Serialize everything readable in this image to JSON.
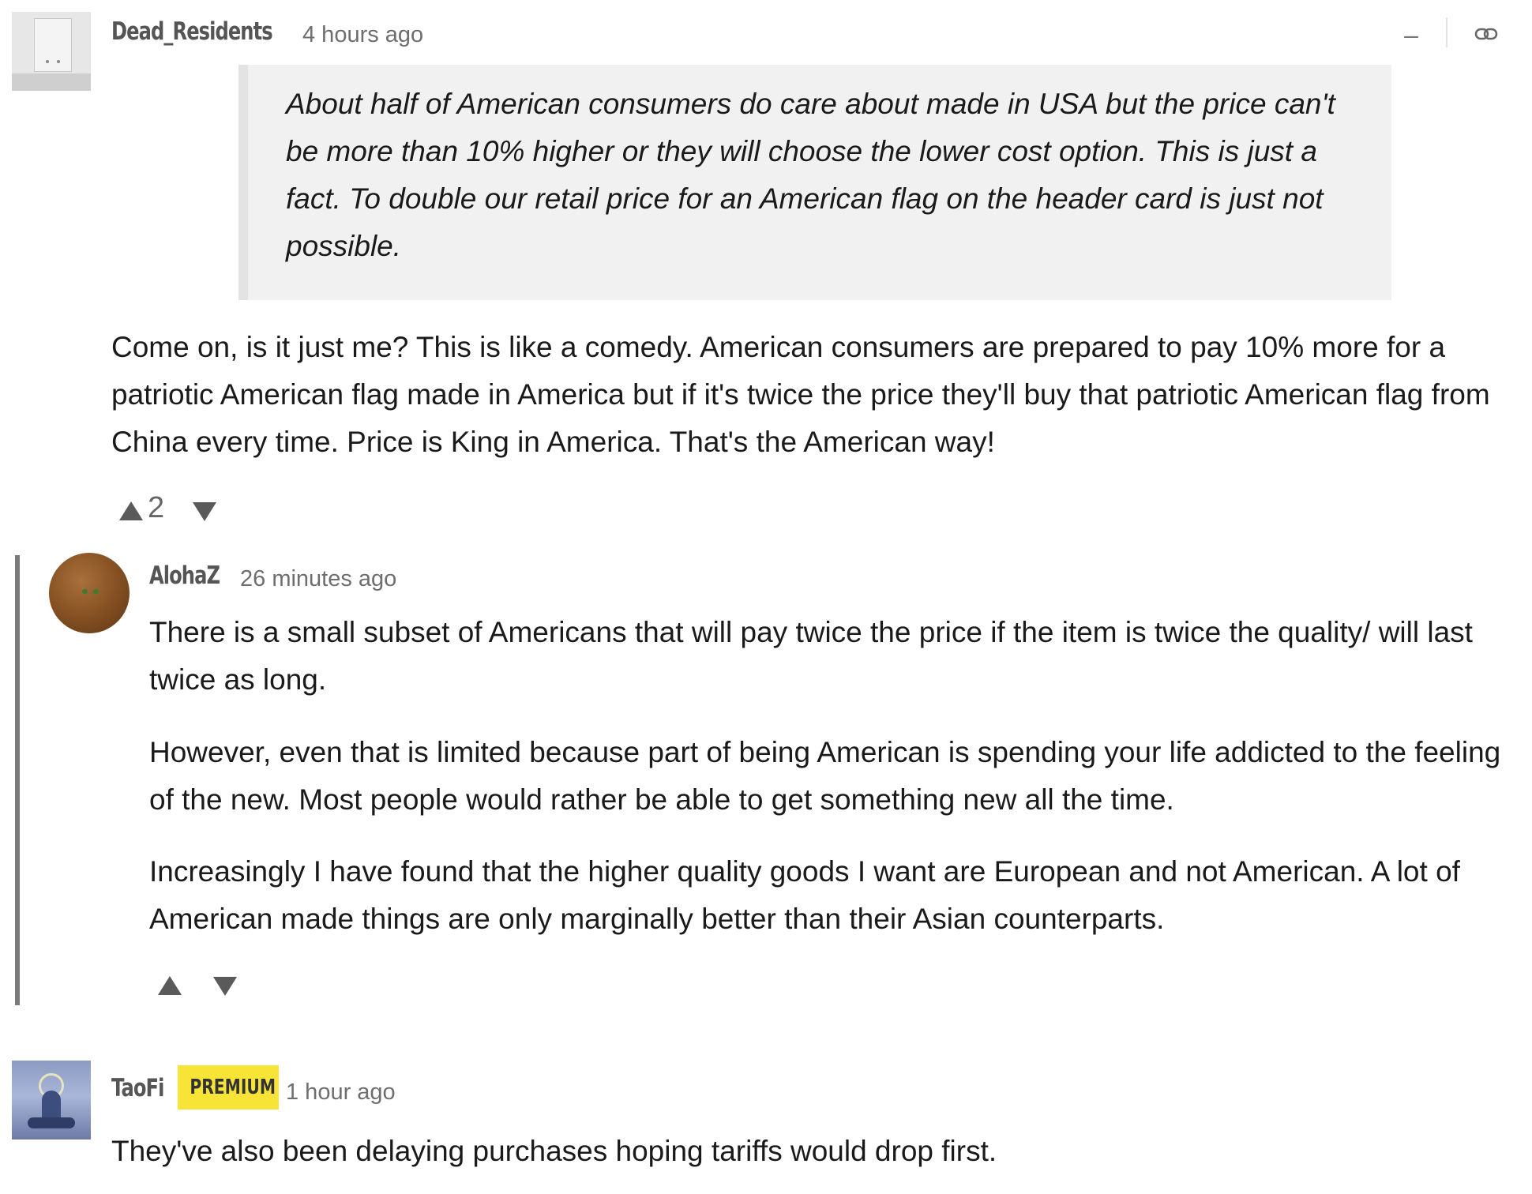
{
  "comments": [
    {
      "username": "Dead_Residents",
      "time": "4 hours ago",
      "quote": "About half of American consumers do care about made in USA but the price can't be more than 10% higher or they will choose the lower cost option. This is just a fact. To double our retail price for an American flag on the header card is just not possible.",
      "body": "Come on, is it just me? This is like a comedy. American consumers are prepared to pay 10% more for a patriotic American flag made in America but if it's twice the price they'll buy that patriotic American flag from China every time. Price is King in America. That's the American way!",
      "votes": "2",
      "controls": {
        "minimize": "–",
        "link_icon": "link-icon"
      }
    },
    {
      "username": "AlohaZ",
      "time": "26 minutes ago",
      "paragraphs": [
        "There is a small subset of Americans that will pay twice the price if the item is twice the quality/ will last twice as long.",
        "However, even that is limited because part of being American is spending your life addicted to the feeling of the new.  Most people would rather be able to get something new all the time.",
        "Increasingly I have found that the higher quality goods I want are European and not American.  A lot of American made things are only marginally better than their Asian counterparts."
      ]
    },
    {
      "username": "TaoFi",
      "badge": "PREMIUM",
      "time": "1 hour ago",
      "body": "They've also been delaying purchases hoping tariffs would drop first."
    }
  ]
}
